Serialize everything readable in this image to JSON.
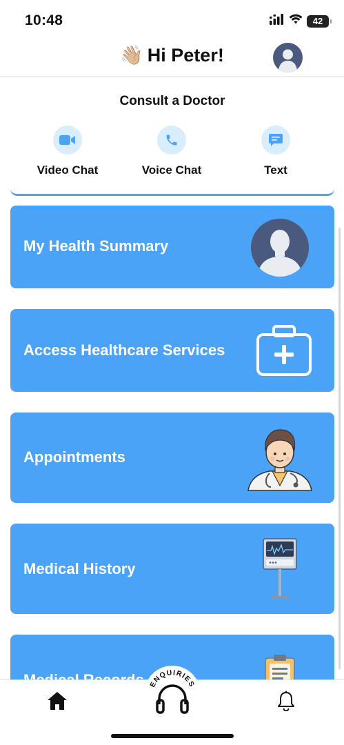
{
  "status_bar": {
    "time": "10:48",
    "battery": "42",
    "icons": [
      "signal-icon",
      "wifi-icon",
      "battery-icon"
    ]
  },
  "header": {
    "wave_emoji": "👋🏼",
    "greeting": "Hi Peter!",
    "avatar": "user-avatar-icon"
  },
  "consult": {
    "title": "Consult a Doctor",
    "options": [
      {
        "label": "Video Chat",
        "icon": "video-camera-icon"
      },
      {
        "label": "Voice Chat",
        "icon": "phone-icon"
      },
      {
        "label": "Text",
        "icon": "chat-bubble-icon"
      }
    ]
  },
  "features": [
    {
      "label": "My Health Summary",
      "icon": "user-silhouette-icon"
    },
    {
      "label": "Access Healthcare Services",
      "icon": "first-aid-kit-icon"
    },
    {
      "label": "Appointments",
      "icon": "doctor-illustration-icon"
    },
    {
      "label": "Medical History",
      "icon": "heart-monitor-icon"
    },
    {
      "label": "Medical Records",
      "icon": "clipboard-icon"
    }
  ],
  "bottom_nav": {
    "home": "home-icon",
    "enquiries_label": "ENQUIRIES",
    "enquiries_icon": "headphones-icon",
    "notifications": "bell-icon"
  },
  "colors": {
    "accent": "#4aa3f7",
    "accent_light": "#d9eefd",
    "avatar_bg": "#4a5a7e",
    "text": "#111111"
  }
}
